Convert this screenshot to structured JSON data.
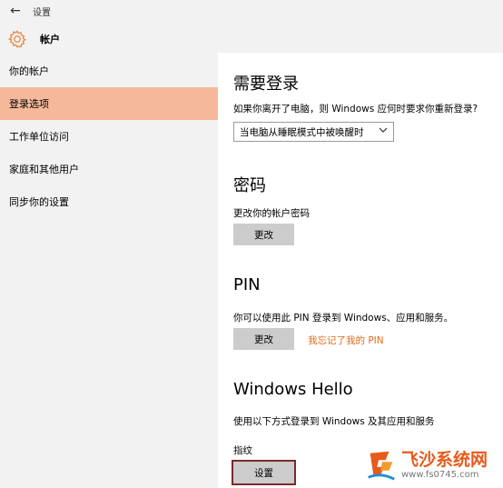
{
  "app": {
    "back_glyph": "←",
    "title": "设置"
  },
  "header": {
    "title": "帐户",
    "icon": "gear-icon",
    "icon_color": "#e8863c"
  },
  "sidebar": {
    "items": [
      {
        "label": "你的帐户",
        "active": false
      },
      {
        "label": "登录选项",
        "active": true
      },
      {
        "label": "工作单位访问",
        "active": false
      },
      {
        "label": "家庭和其他用户",
        "active": false
      },
      {
        "label": "同步你的设置",
        "active": false
      }
    ],
    "active_color": "#f5b89a"
  },
  "main": {
    "require_signin": {
      "title": "需要登录",
      "description": "如果你离开了电脑，则 Windows 应何时要求你重新登录?",
      "select_value": "当电脑从睡眠模式中被唤醒时"
    },
    "password": {
      "title": "密码",
      "description": "更改你的帐户密码",
      "button": "更改"
    },
    "pin": {
      "title": "PIN",
      "description": "你可以使用此 PIN 登录到 Windows、应用和服务。",
      "button": "更改",
      "link": "我忘记了我的 PIN"
    },
    "hello": {
      "title": "Windows Hello",
      "description": "使用以下方式登录到 Windows 及其应用和服务",
      "label": "指纹",
      "button": "设置"
    }
  },
  "watermark": {
    "brand": "飞沙系统网",
    "url": "www.fs0745.com"
  },
  "colors": {
    "accent": "#e06b1c",
    "button_bg": "#cccccc",
    "highlight_border": "#7b2b2b"
  }
}
